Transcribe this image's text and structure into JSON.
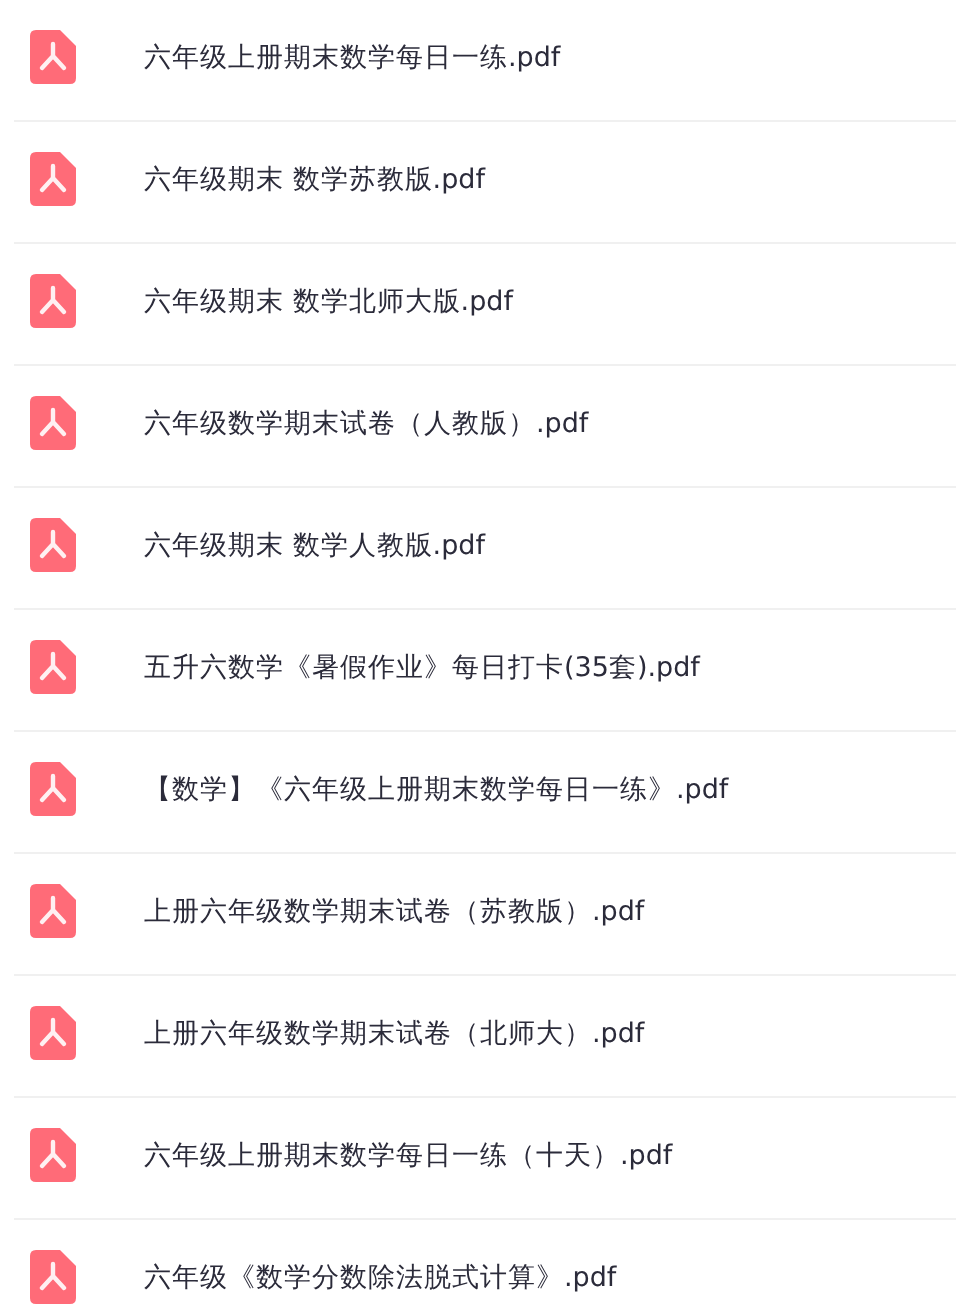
{
  "files": [
    {
      "name": "六年级上册期末数学每日一练.pdf"
    },
    {
      "name": "六年级期末 数学苏教版.pdf"
    },
    {
      "name": "六年级期末 数学北师大版.pdf"
    },
    {
      "name": "六年级数学期末试卷（人教版）.pdf"
    },
    {
      "name": "六年级期末 数学人教版.pdf"
    },
    {
      "name": "五升六数学《暑假作业》每日打卡(35套).pdf"
    },
    {
      "name": "【数学】《六年级上册期末数学每日一练》.pdf"
    },
    {
      "name": "上册六年级数学期末试卷（苏教版）.pdf"
    },
    {
      "name": "上册六年级数学期末试卷（北师大）.pdf"
    },
    {
      "name": "六年级上册期末数学每日一练（十天）.pdf"
    },
    {
      "name": "六年级《数学分数除法脱式计算》.pdf"
    }
  ]
}
